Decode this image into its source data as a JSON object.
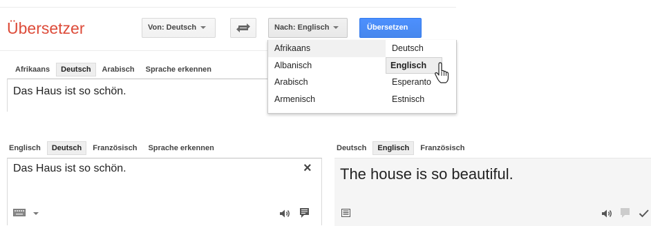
{
  "top": {
    "title": "Übersetzer",
    "from_button": "Von: Deutsch",
    "to_button": "Nach: Englisch",
    "translate_button": "Übersetzen",
    "source_tabs": [
      "Afrikaans",
      "Deutsch",
      "Arabisch",
      "Sprache erkennen"
    ],
    "selected_source_tab": "Deutsch",
    "source_text": "Das Haus ist so schön.",
    "dropdown": {
      "col1": [
        "Afrikaans",
        "Albanisch",
        "Arabisch",
        "Armenisch"
      ],
      "col2": [
        "Deutsch",
        "Englisch",
        "Esperanto",
        "Estnisch"
      ],
      "hovered": "Englisch"
    }
  },
  "bottom": {
    "source_tabs": [
      "Englisch",
      "Deutsch",
      "Französisch",
      "Sprache erkennen"
    ],
    "selected_source_tab": "Deutsch",
    "target_tabs": [
      "Deutsch",
      "Englisch",
      "Französisch"
    ],
    "selected_target_tab": "Englisch",
    "source_text": "Das Haus ist so schön.",
    "translation_text": "The house is so beautiful.",
    "clear_symbol": "×"
  },
  "colors": {
    "title": "#dd4b39",
    "accent_blue": "#4d90fe"
  },
  "icons": [
    "swap-icon",
    "keyboard-icon",
    "speaker-icon",
    "feedback-icon",
    "list-icon",
    "checkmark-icon",
    "hand-cursor-icon",
    "chevron-down-icon"
  ]
}
